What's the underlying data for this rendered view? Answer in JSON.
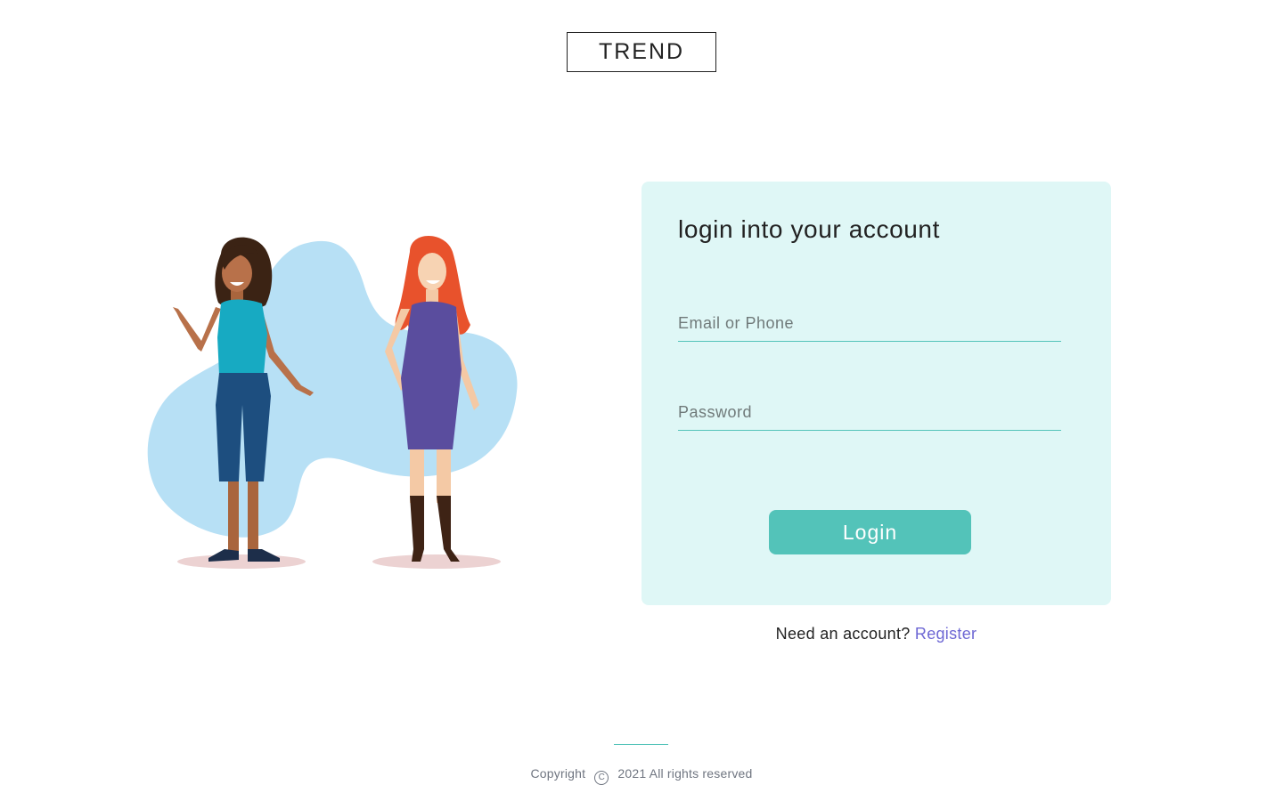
{
  "brand": {
    "logo_text": "TREND"
  },
  "login_card": {
    "title": "login into your account",
    "email_placeholder": "Email or Phone",
    "password_placeholder": "Password",
    "login_label": "Login"
  },
  "register": {
    "prompt": "Need an account?",
    "link_label": "Register"
  },
  "footer": {
    "copyright_label": "Copyright",
    "year_text": "2021 All rights reserved"
  },
  "colors": {
    "accent": "#53c3b9",
    "card_background": "#dff7f6",
    "link": "#6d67d4",
    "blob": "#b7e0f5"
  },
  "icons": {
    "copyright": "copyright-icon"
  }
}
